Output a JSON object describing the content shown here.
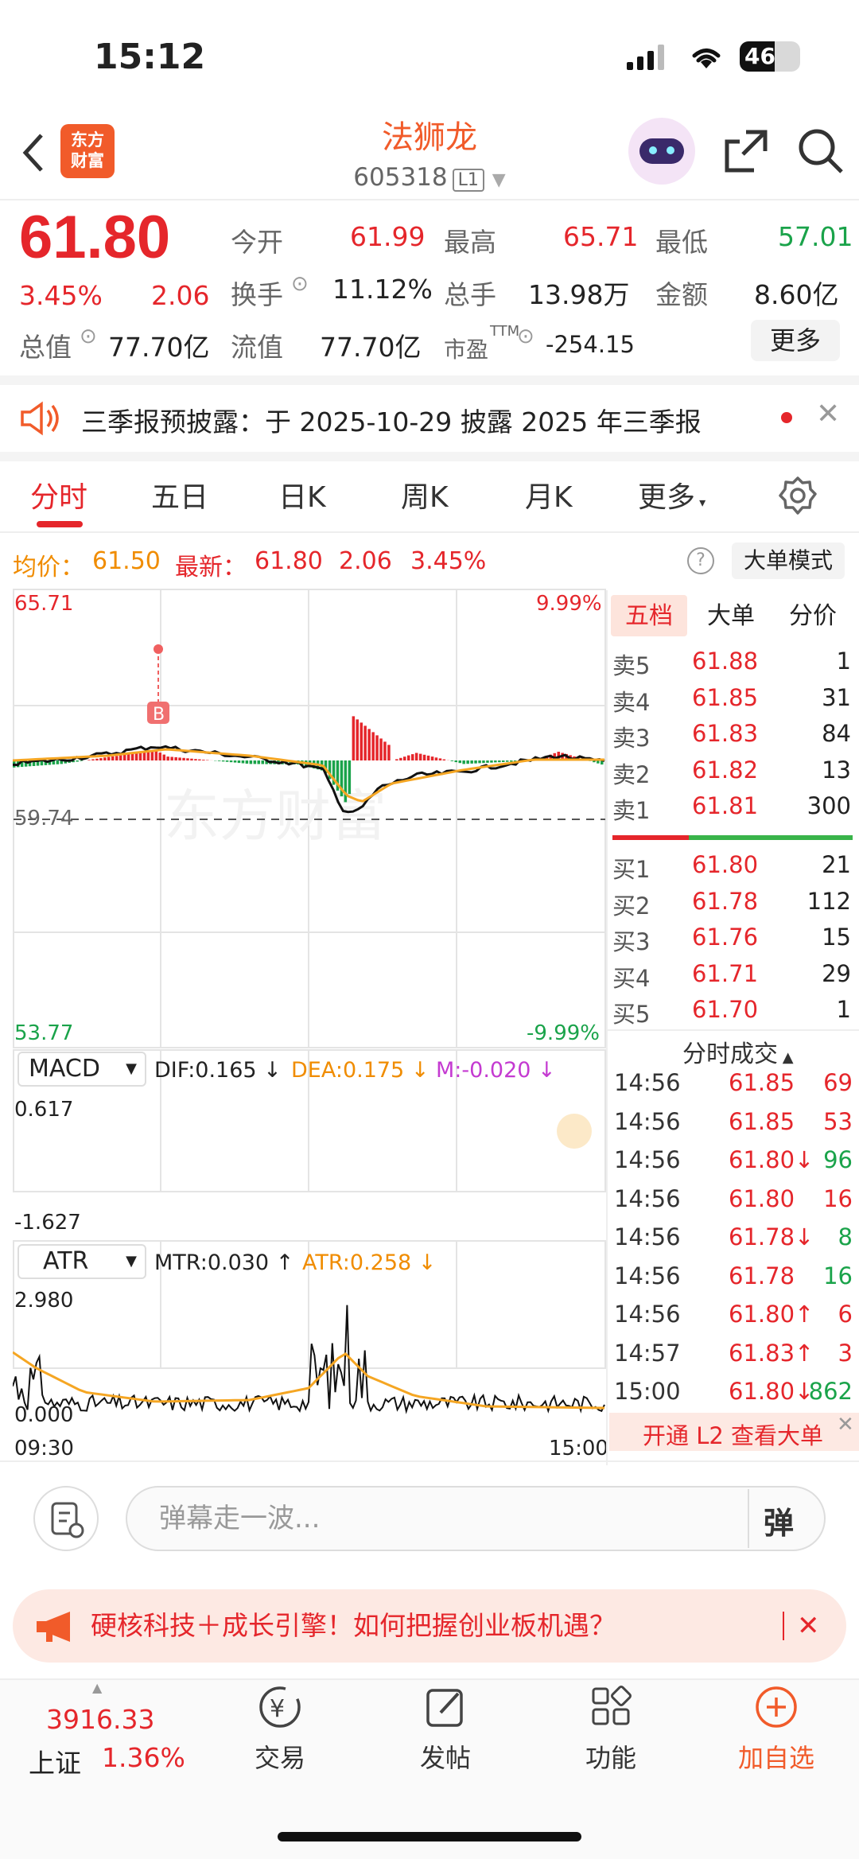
{
  "status_bar": {
    "time": "15:12",
    "battery": "46"
  },
  "header": {
    "title": "法狮龙",
    "code": "605318",
    "level": "L1"
  },
  "quote": {
    "price": "61.80",
    "change_pct": "3.45%",
    "change": "2.06",
    "open_label": "今开",
    "open": "61.99",
    "high_label": "最高",
    "high": "65.71",
    "low_label": "最低",
    "low": "57.01",
    "turnover_label": "换手",
    "turnover": "11.12%",
    "volume_label": "总手",
    "volume": "13.98万",
    "amount_label": "金额",
    "amount": "8.60亿",
    "mcap_label": "总值",
    "mcap": "77.70亿",
    "float_label": "流值",
    "float": "77.70亿",
    "pe_label": "市盈",
    "pe_sup": "TTM",
    "pe": "-254.15",
    "more": "更多"
  },
  "notice": {
    "text": "三季报预披露：于 2025-10-29 披露 2025 年三季报"
  },
  "tabs": [
    "分时",
    "五日",
    "日K",
    "周K",
    "月K",
    "更多"
  ],
  "legend": {
    "avg_label": "均价：",
    "avg": "61.50",
    "latest_label": "最新：",
    "latest": "61.80",
    "latest_chg": "2.06",
    "latest_pct": "3.45%",
    "mode": "大单模式"
  },
  "chart_labels": {
    "top": "65.71",
    "top_pct": "9.99%",
    "mid": "59.74",
    "bottom": "53.77",
    "bottom_pct": "-9.99%",
    "watermark": "东方财富",
    "marker": "B"
  },
  "macd": {
    "name": "MACD",
    "dif": "DIF:0.165 ↓",
    "dea": "DEA:0.175 ↓",
    "m": "M:-0.020 ↓",
    "max": "0.617",
    "min": "-1.627"
  },
  "atr": {
    "name": "ATR",
    "mtr": "MTR:0.030 ↑",
    "atr": "ATR:0.258 ↓",
    "max": "2.980",
    "min": "0.000"
  },
  "time_axis": {
    "start": "09:30",
    "end": "15:00"
  },
  "orderbook": {
    "tabs": [
      "五档",
      "大单",
      "分价"
    ],
    "asks": [
      {
        "label": "卖5",
        "price": "61.88",
        "vol": "1"
      },
      {
        "label": "卖4",
        "price": "61.85",
        "vol": "31"
      },
      {
        "label": "卖3",
        "price": "61.83",
        "vol": "84"
      },
      {
        "label": "卖2",
        "price": "61.82",
        "vol": "13"
      },
      {
        "label": "卖1",
        "price": "61.81",
        "vol": "300"
      }
    ],
    "bids": [
      {
        "label": "买1",
        "price": "61.80",
        "vol": "21"
      },
      {
        "label": "买2",
        "price": "61.78",
        "vol": "112"
      },
      {
        "label": "买3",
        "price": "61.76",
        "vol": "15"
      },
      {
        "label": "买4",
        "price": "61.71",
        "vol": "29"
      },
      {
        "label": "买5",
        "price": "61.70",
        "vol": "1"
      }
    ],
    "trades_title": "分时成交",
    "trades": [
      {
        "time": "14:56",
        "price": "61.85",
        "vol": "69",
        "c": "red"
      },
      {
        "time": "14:56",
        "price": "61.85",
        "vol": "53",
        "c": "red"
      },
      {
        "time": "14:56",
        "price": "61.80↓",
        "vol": "96",
        "c": "green"
      },
      {
        "time": "14:56",
        "price": "61.80",
        "vol": "16",
        "c": "red"
      },
      {
        "time": "14:56",
        "price": "61.78↓",
        "vol": "8",
        "c": "green"
      },
      {
        "time": "14:56",
        "price": "61.78",
        "vol": "16",
        "c": "green"
      },
      {
        "time": "14:56",
        "price": "61.80↑",
        "vol": "6",
        "c": "red"
      },
      {
        "time": "14:57",
        "price": "61.83↑",
        "vol": "3",
        "c": "red"
      },
      {
        "time": "15:00",
        "price": "61.80↓",
        "vol": "862",
        "c": "green"
      }
    ],
    "l2_banner": "开通 L2 查看大单"
  },
  "comment": {
    "placeholder": "弹幕走一波...",
    "barrage": "弹"
  },
  "promo": {
    "text": "硬核科技＋成长引擎！如何把握创业板机遇？"
  },
  "bottom_nav": {
    "index_value": "3916.33",
    "index_name": "上证",
    "index_pct": "1.36%",
    "items": [
      "交易",
      "发帖",
      "功能",
      "加自选"
    ]
  },
  "colors": {
    "up": "#e5262b",
    "down": "#1aa34a",
    "brand": "#f15b2a",
    "line": "#2f6fb7",
    "avg": "#f5a623"
  }
}
